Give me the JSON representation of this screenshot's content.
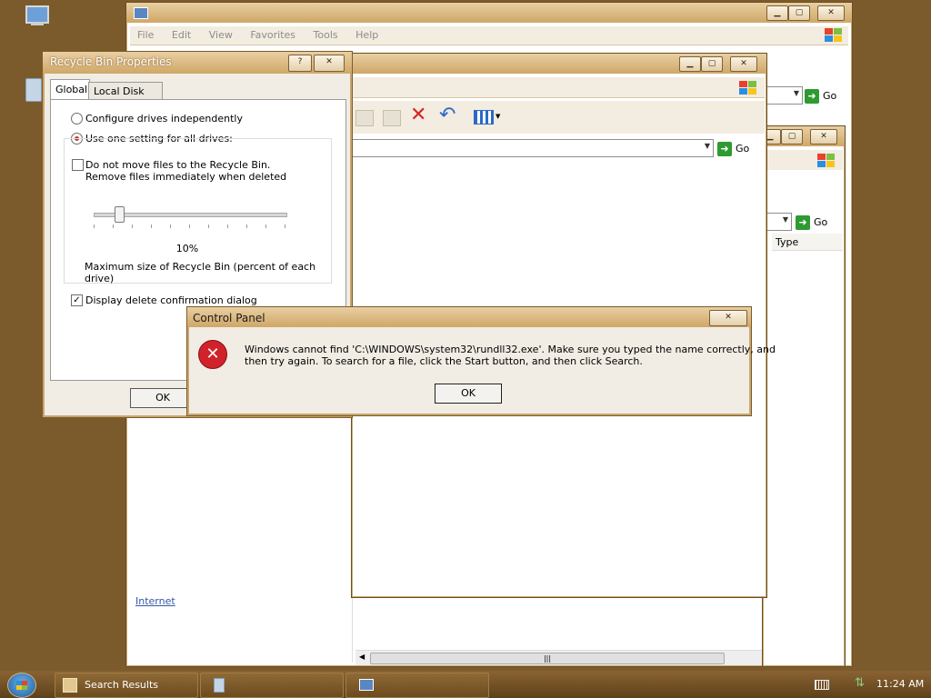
{
  "explorer_back": {
    "menu": [
      "File",
      "Edit",
      "View",
      "Favorites",
      "Tools",
      "Help"
    ],
    "go_label": "Go",
    "sidebar_link": "Internet"
  },
  "explorer_mid": {
    "go_label": "Go"
  },
  "explorer_right": {
    "go_label": "Go",
    "column_header": "Type"
  },
  "recycle_props": {
    "title": "Recycle Bin Properties",
    "tabs": [
      "Global",
      "Local Disk (C:)"
    ],
    "radio_independent": "Configure drives independently",
    "radio_one_setting": "Use one setting for all drives:",
    "checkbox_no_move_line1": "Do not move files to the Recycle Bin.",
    "checkbox_no_move_line2": "Remove files immediately when deleted",
    "slider_value": "10%",
    "slider_fraction": 0.1,
    "max_size_label": "Maximum size of Recycle Bin (percent of each drive)",
    "confirm_checkbox": "Display delete confirmation dialog",
    "confirm_checked": true,
    "ok_label": "OK",
    "help_glyph": "?"
  },
  "error_dialog": {
    "title": "Control Panel",
    "message_line1": "Windows cannot find 'C:\\WINDOWS\\system32\\rundll32.exe'. Make sure you typed the name correctly, and",
    "message_line2": "then try again. To search for a file, click the Start button, and then click Search.",
    "ok_label": "OK",
    "icon": "error-icon"
  },
  "taskbar": {
    "items": [
      "Search Results",
      "",
      ""
    ],
    "clock": "11:24 AM"
  },
  "colors": {
    "desktop": "#7b5a2c",
    "error_red": "#d0222a",
    "titlebar": "#cfa767"
  }
}
